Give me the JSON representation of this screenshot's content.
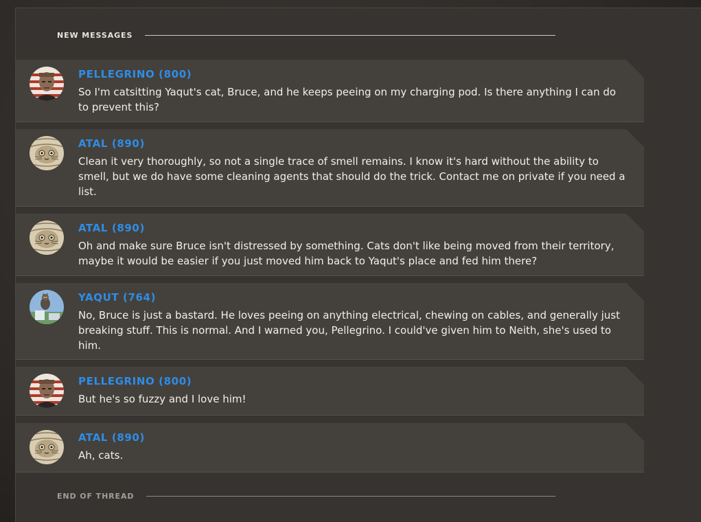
{
  "thread": {
    "new_label": "NEW MESSAGES",
    "end_label": "END OF THREAD"
  },
  "messages": [
    {
      "author": "PELLEGRINO (800)",
      "avatar": "pellegrino-avatar",
      "text": "So I'm catsitting Yaqut's cat, Bruce, and he keeps peeing on my charging pod. Is there anything I can do to prevent this?"
    },
    {
      "author": "ATAL (890)",
      "avatar": "atal-avatar",
      "text": "Clean it very thoroughly, so not a single trace of smell remains. I know it's hard without the ability to smell, but we do have some cleaning agents that should do the trick. Contact me on private if you need a list."
    },
    {
      "author": "ATAL (890)",
      "avatar": "atal-avatar",
      "text": "Oh and make sure Bruce isn't distressed by something. Cats don't like being moved from their territory, maybe it would be easier if you just moved him back to Yaqut's place and fed him there?"
    },
    {
      "author": "YAQUT (764)",
      "avatar": "yaqut-avatar",
      "text": "No, Bruce is just a bastard. He loves peeing on anything electrical, chewing on cables, and generally just breaking stuff. This is normal. And I warned you, Pellegrino. I could've given him to Neith, she's used to him."
    },
    {
      "author": "PELLEGRINO (800)",
      "avatar": "pellegrino-avatar",
      "text": "But he's so fuzzy and I love him!"
    },
    {
      "author": "ATAL (890)",
      "avatar": "atal-avatar",
      "text": "Ah, cats."
    }
  ],
  "colors": {
    "author_name": "#2f8de6",
    "message_bg": "#44403c",
    "panel_bg": "#363330",
    "message_text": "#f2efea"
  }
}
